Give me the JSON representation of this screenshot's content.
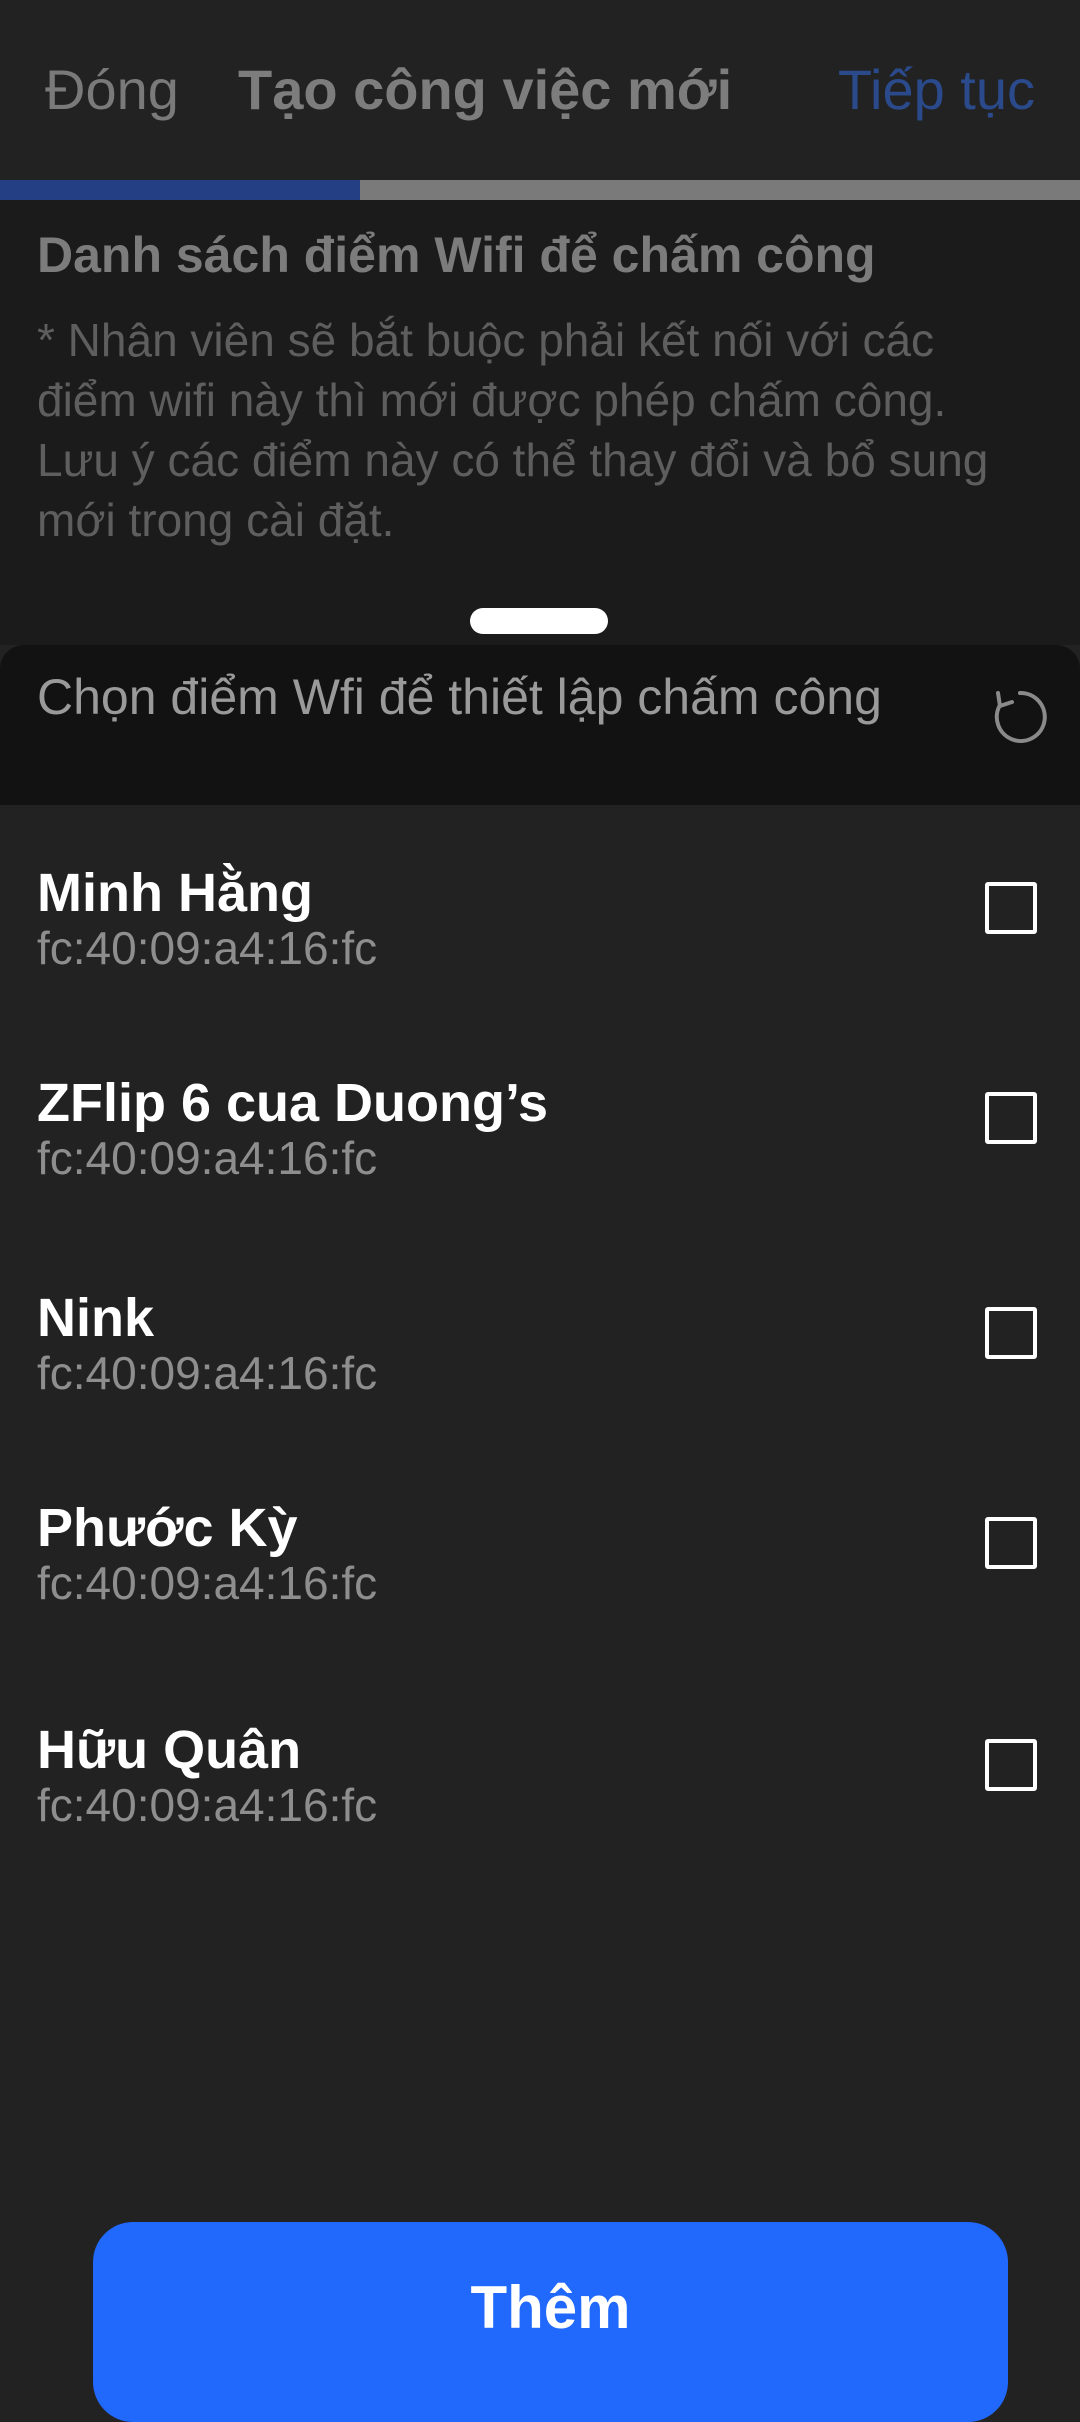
{
  "header": {
    "close_label": "Đóng",
    "title": "Tạo công việc mới",
    "next_label": "Tiếp tục",
    "progress": 0.333
  },
  "section": {
    "title": "Danh sách điểm Wifi để chấm công",
    "description": "* Nhân viên sẽ bắt buộc phải kết nối với các điểm wifi này thì mới được phép chấm công. Lưu ý các điểm này có thể thay đổi và bổ sung mới trong cài đặt."
  },
  "sheet": {
    "prompt": "Chọn điểm Wfi để thiết lập chấm công",
    "refresh_icon": "refresh-icon",
    "wifi_items": [
      {
        "name": "Minh Hằng",
        "mac": "fc:40:09:a4:16:fc",
        "checked": false
      },
      {
        "name": "ZFlip 6 cua Duong’s",
        "mac": "fc:40:09:a4:16:fc",
        "checked": false
      },
      {
        "name": "Nink",
        "mac": "fc:40:09:a4:16:fc",
        "checked": false
      },
      {
        "name": "Phước Kỳ",
        "mac": "fc:40:09:a4:16:fc",
        "checked": false
      },
      {
        "name": "Hữu Quân",
        "mac": "fc:40:09:a4:16:fc",
        "checked": false
      }
    ],
    "add_label": "Thêm"
  },
  "colors": {
    "accent": "#2168fc",
    "background": "#222222"
  }
}
